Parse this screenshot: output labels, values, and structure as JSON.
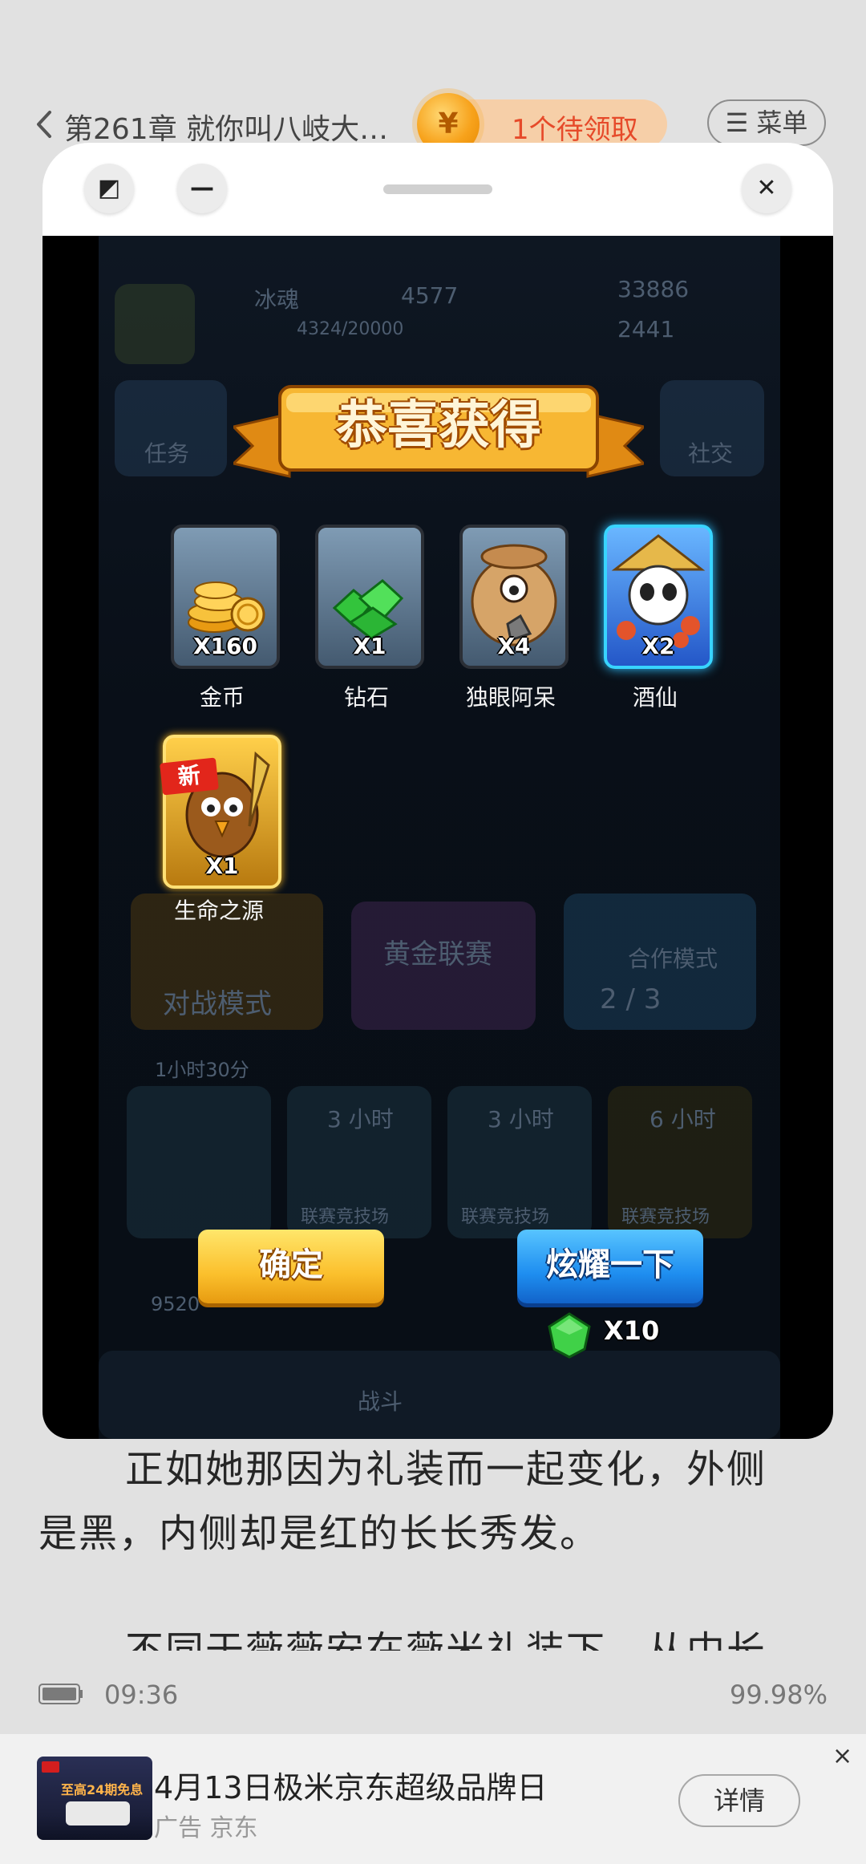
{
  "topbar": {
    "chapter_title": "第261章 就你叫八岐大…",
    "reward_pill": "1个待领取",
    "coin_glyph": "¥",
    "menu_label": "☰ 菜单"
  },
  "popup": {
    "expand_glyph": "◩",
    "minimize_glyph": "—",
    "close_glyph": "✕"
  },
  "game": {
    "background_texts": [
      "冰魂",
      "4577",
      "33886",
      "2441",
      "4324/20000",
      "任务",
      "社交",
      "黄金联赛",
      "对战模式",
      "合作模式",
      "2 / 3",
      "1小时30分",
      "3 小时",
      "3 小时",
      "6 小时",
      "联赛竞技场",
      "联赛竞技场",
      "联赛竞技场",
      "战斗",
      "9520"
    ],
    "banner": "恭喜获得",
    "rewards": [
      {
        "count": "X160",
        "name": "金币"
      },
      {
        "count": "X1",
        "name": "钻石"
      },
      {
        "count": "X4",
        "name": "独眼阿呆"
      },
      {
        "count": "X2",
        "name": "酒仙"
      },
      {
        "count": "X1",
        "name": "生命之源",
        "badge": "新"
      }
    ],
    "confirm_label": "确定",
    "show_label": "炫耀一下",
    "gem_cost": "X10"
  },
  "reader": {
    "lines": [
      "正如她那因为礼装而一起变化，外侧",
      "是黑，内侧却是红的长长秀发。",
      "不同于薇薇安在薇米礼装下，从中长"
    ]
  },
  "status": {
    "time": "09:36",
    "progress": "99.98%"
  },
  "ad": {
    "thumb_text": "至高24期免息",
    "title": "4月13日极米京东超级品牌日",
    "sub": "广告   京东",
    "detail_label": "详情",
    "close_glyph": "×"
  },
  "colors": {
    "page_bg": "#e1e1e1",
    "reward_text": "#e64a2a",
    "confirm_button": "#fbc02d",
    "show_button": "#1e8ef0"
  }
}
